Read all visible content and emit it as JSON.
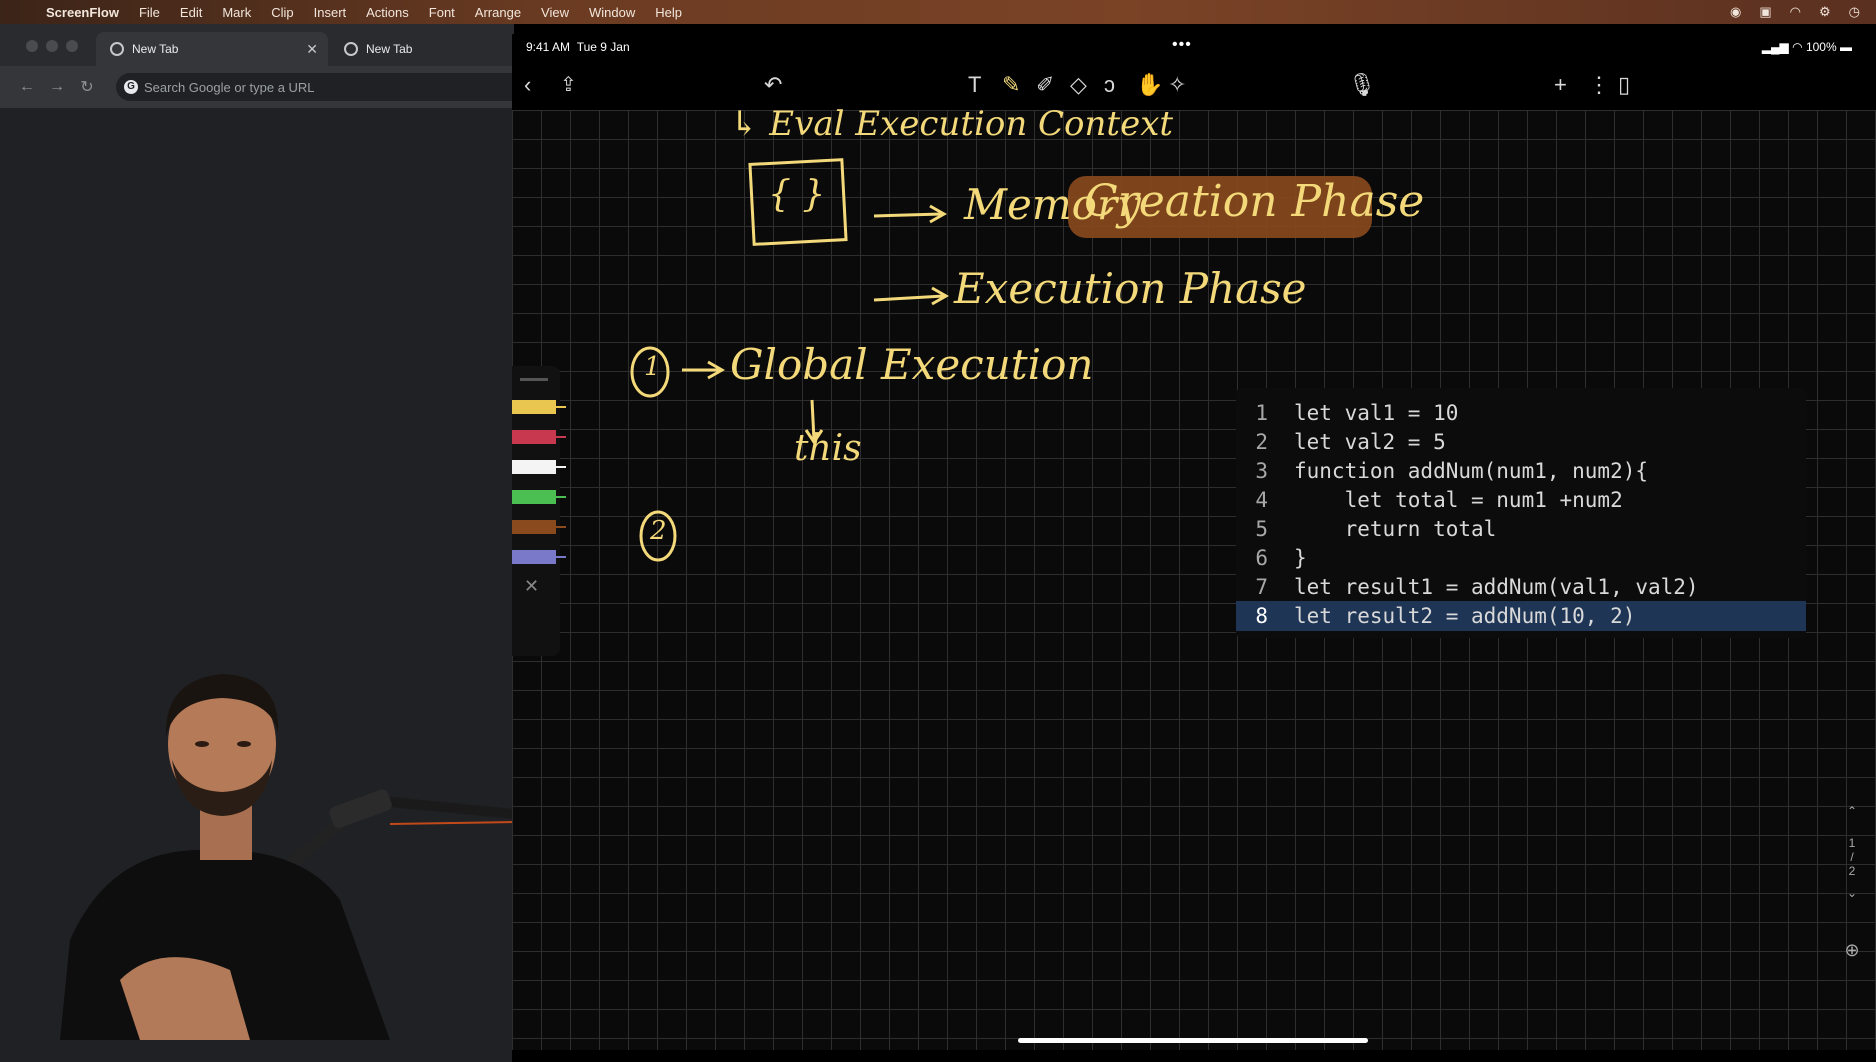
{
  "menubar": {
    "items": [
      "ScreenFlow",
      "File",
      "Edit",
      "Mark",
      "Clip",
      "Insert",
      "Actions",
      "Font",
      "Arrange",
      "View",
      "Window",
      "Help"
    ],
    "right_icons": [
      "mic-indicator-icon",
      "screen-record-icon",
      "wifi-icon",
      "control-center-icon",
      "clock-icon"
    ]
  },
  "browser": {
    "tabs": [
      {
        "label": "New Tab",
        "active": true
      },
      {
        "label": "New Tab",
        "active": false
      }
    ],
    "omnibox_placeholder": "Search Google or type a URL"
  },
  "ipad": {
    "status": {
      "time": "9:41 AM",
      "date": "Tue 9 Jan",
      "battery": "100%"
    },
    "handwriting": {
      "top_line": "↳ Eval Execution Context",
      "memory": "Memory",
      "creation_phase": "Creation Phase",
      "execution_phase": "Execution Phase",
      "braces": "{ }",
      "step1": "1",
      "global_execution": "Global Execution",
      "this": "this",
      "step2": "2"
    },
    "code": {
      "lines": [
        {
          "no": "1",
          "text": "let val1 = 10"
        },
        {
          "no": "2",
          "text": "let val2 = 5"
        },
        {
          "no": "3",
          "text": "function addNum(num1, num2){"
        },
        {
          "no": "4",
          "text": "    let total = num1 +num2"
        },
        {
          "no": "5",
          "text": "    return total"
        },
        {
          "no": "6",
          "text": "}"
        },
        {
          "no": "7",
          "text": "let result1 = addNum(val1, val2)"
        },
        {
          "no": "8",
          "text": "let result2 = addNum(10, 2)"
        }
      ],
      "highlighted_line": 8
    },
    "page_nav": {
      "current": "1",
      "total": "2"
    },
    "accent": "#f3d97a",
    "highlight_color": "#8a4a1e"
  }
}
